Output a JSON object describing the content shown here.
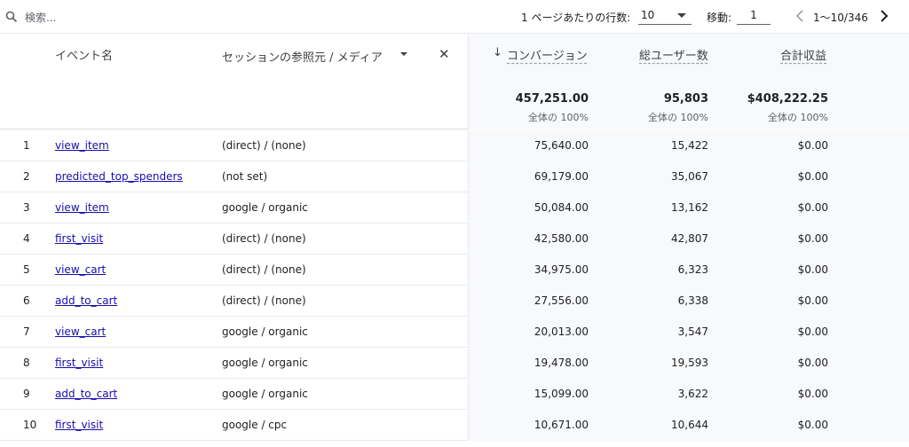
{
  "toolbar": {
    "search_placeholder": "検索...",
    "rows_per_page_label": "1 ページあたりの行数:",
    "rows_per_page_value": "10",
    "goto_label": "移動:",
    "goto_value": "1",
    "page_range": "1〜10/346"
  },
  "columns": {
    "event_name": "イベント名",
    "dimension": "セッションの参照元 / メディア",
    "conversions": "コンバージョン",
    "total_users": "総ユーザー数",
    "total_revenue": "合計収益"
  },
  "totals": {
    "conversions": "457,251.00",
    "total_users": "95,803",
    "total_revenue": "$408,222.25",
    "share_label": "全体の 100%"
  },
  "rows": [
    {
      "idx": "1",
      "event": "view_item",
      "source": "(direct) / (none)",
      "conversions": "75,640.00",
      "users": "15,422",
      "revenue": "$0.00"
    },
    {
      "idx": "2",
      "event": "predicted_top_spenders",
      "source": "(not set)",
      "conversions": "69,179.00",
      "users": "35,067",
      "revenue": "$0.00"
    },
    {
      "idx": "3",
      "event": "view_item",
      "source": "google / organic",
      "conversions": "50,084.00",
      "users": "13,162",
      "revenue": "$0.00"
    },
    {
      "idx": "4",
      "event": "first_visit",
      "source": "(direct) / (none)",
      "conversions": "42,580.00",
      "users": "42,807",
      "revenue": "$0.00"
    },
    {
      "idx": "5",
      "event": "view_cart",
      "source": "(direct) / (none)",
      "conversions": "34,975.00",
      "users": "6,323",
      "revenue": "$0.00"
    },
    {
      "idx": "6",
      "event": "add_to_cart",
      "source": "(direct) / (none)",
      "conversions": "27,556.00",
      "users": "6,338",
      "revenue": "$0.00"
    },
    {
      "idx": "7",
      "event": "view_cart",
      "source": "google / organic",
      "conversions": "20,013.00",
      "users": "3,547",
      "revenue": "$0.00"
    },
    {
      "idx": "8",
      "event": "first_visit",
      "source": "google / organic",
      "conversions": "19,478.00",
      "users": "19,593",
      "revenue": "$0.00"
    },
    {
      "idx": "9",
      "event": "add_to_cart",
      "source": "google / organic",
      "conversions": "15,099.00",
      "users": "3,622",
      "revenue": "$0.00"
    },
    {
      "idx": "10",
      "event": "first_visit",
      "source": "google / cpc",
      "conversions": "10,671.00",
      "users": "10,644",
      "revenue": "$0.00"
    }
  ]
}
